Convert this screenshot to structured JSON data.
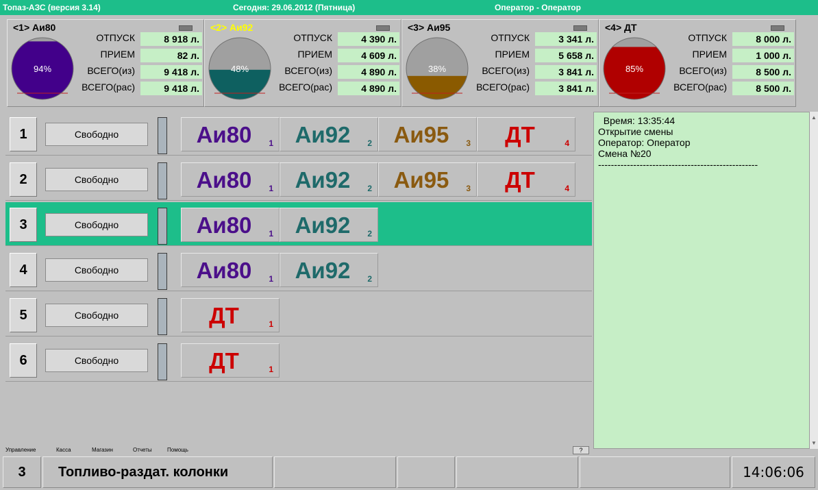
{
  "titlebar": {
    "app": "Топаз-АЗС  (версия 3.14)",
    "date": "Сегодня: 29.06.2012  (Пятница)",
    "operator": "Оператор - Оператор"
  },
  "tank_labels": {
    "out": "ОТПУСК",
    "in": "ПРИЕМ",
    "total_from": "ВСЕГО(из)",
    "total_calc": "ВСЕГО(рас)"
  },
  "tanks": [
    {
      "title": "<1> Аи80",
      "title_color": "#000000",
      "percent": "94%",
      "level": 0.94,
      "fill": "#42008a",
      "out": "8 918 л.",
      "in": "82 л.",
      "total_from": "9 418 л.",
      "total_calc": "9 418 л."
    },
    {
      "title": "<2> Аи92",
      "title_color": "#ffff00",
      "percent": "48%",
      "level": 0.48,
      "fill": "#0e6060",
      "out": "4 390 л.",
      "in": "4 609 л.",
      "total_from": "4 890 л.",
      "total_calc": "4 890 л."
    },
    {
      "title": "<3> Аи95",
      "title_color": "#000000",
      "percent": "38%",
      "level": 0.38,
      "fill": "#8a5a00",
      "out": "3 341 л.",
      "in": "5 658 л.",
      "total_from": "3 841 л.",
      "total_calc": "3 841 л."
    },
    {
      "title": "<4> ДТ",
      "title_color": "#000000",
      "percent": "85%",
      "level": 0.85,
      "fill": "#b00000",
      "out": "8 000 л.",
      "in": "1 000 л.",
      "total_from": "8 500 л.",
      "total_calc": "8 500 л."
    }
  ],
  "fuel_colors": {
    "Аи80": "#4b0f8a",
    "Аи92": "#1e6a6a",
    "Аи95": "#8a5a10",
    "ДТ": "#cc0000"
  },
  "pumps": [
    {
      "num": "1",
      "status": "Свободно",
      "active": false,
      "nozzles": [
        {
          "fuel": "Аи80",
          "idx": "1"
        },
        {
          "fuel": "Аи92",
          "idx": "2"
        },
        {
          "fuel": "Аи95",
          "idx": "3"
        },
        {
          "fuel": "ДТ",
          "idx": "4"
        }
      ]
    },
    {
      "num": "2",
      "status": "Свободно",
      "active": false,
      "nozzles": [
        {
          "fuel": "Аи80",
          "idx": "1"
        },
        {
          "fuel": "Аи92",
          "idx": "2"
        },
        {
          "fuel": "Аи95",
          "idx": "3"
        },
        {
          "fuel": "ДТ",
          "idx": "4"
        }
      ]
    },
    {
      "num": "3",
      "status": "Свободно",
      "active": true,
      "nozzles": [
        {
          "fuel": "Аи80",
          "idx": "1"
        },
        {
          "fuel": "Аи92",
          "idx": "2"
        }
      ]
    },
    {
      "num": "4",
      "status": "Свободно",
      "active": false,
      "nozzles": [
        {
          "fuel": "Аи80",
          "idx": "1"
        },
        {
          "fuel": "Аи92",
          "idx": "2"
        }
      ]
    },
    {
      "num": "5",
      "status": "Свободно",
      "active": false,
      "nozzles": [
        {
          "fuel": "ДТ",
          "idx": "1"
        }
      ]
    },
    {
      "num": "6",
      "status": "Свободно",
      "active": false,
      "nozzles": [
        {
          "fuel": "ДТ",
          "idx": "1"
        }
      ]
    }
  ],
  "log": {
    "lines": [
      "  Время: 13:35:44",
      "Открытие смены",
      "Оператор: Оператор",
      "Смена №20",
      "--------------------------------------------------"
    ]
  },
  "menu": {
    "items": [
      "Управление",
      "Касса",
      "Магазин",
      "Отчеты",
      "Помощь"
    ],
    "help": "?"
  },
  "statusbar": {
    "num": "3",
    "title": "Топливо-раздат. колонки",
    "time": "14:06:06"
  }
}
